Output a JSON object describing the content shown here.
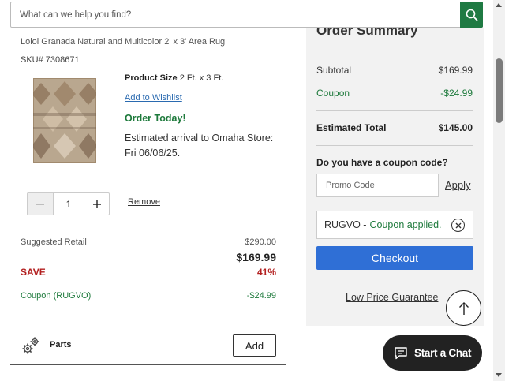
{
  "search": {
    "placeholder": "What can we help you find?",
    "button_icon": "search-icon"
  },
  "product": {
    "name": "Loloi Granada Natural and Multicolor 2' x 3' Area Rug",
    "sku": "SKU# 7308671",
    "size_label": "Product Size",
    "size_value": "2 Ft. x 3 Ft.",
    "wishlist_link": "Add to Wishlist",
    "order_today": "Order Today!",
    "arrival": "Estimated arrival to Omaha Store: Fri 06/06/25.",
    "quantity": "1",
    "remove_link": "Remove"
  },
  "pricing": {
    "suggested_label": "Suggested Retail",
    "suggested_value": "$290.00",
    "price": "$169.99",
    "save_label": "SAVE",
    "save_percent": "41%",
    "coupon_label": "Coupon (RUGVO)",
    "coupon_value": "-$24.99"
  },
  "parts": {
    "label": "Parts",
    "add_button": "Add"
  },
  "summary": {
    "title": "Order Summary",
    "subtotal_label": "Subtotal",
    "subtotal_value": "$169.99",
    "coupon_label": "Coupon",
    "coupon_value": "-$24.99",
    "total_label": "Estimated Total",
    "total_value": "$145.00",
    "coupon_question": "Do you have a coupon code?",
    "promo_placeholder": "Promo Code",
    "apply_label": "Apply",
    "applied_code": "RUGVO -",
    "applied_message": "Coupon applied.",
    "checkout_label": "Checkout",
    "low_price_link": "Low Price Guarantee"
  },
  "chat": {
    "label": "Start a Chat"
  },
  "colors": {
    "brand_green": "#1f7a43",
    "checkout_blue": "#2f6fd6",
    "save_red": "#b32020",
    "summary_bg": "#f2f2f2"
  }
}
